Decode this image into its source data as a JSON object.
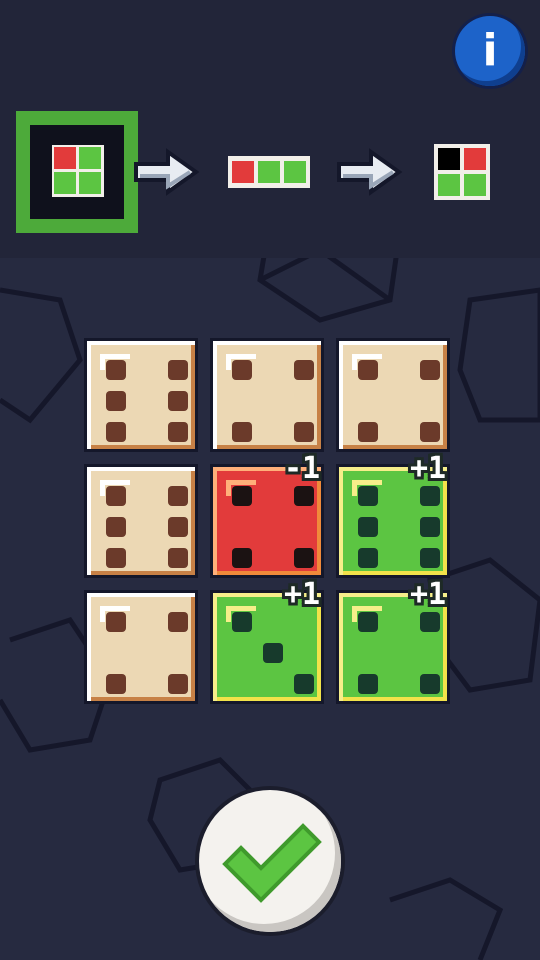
{
  "info_button": {
    "label": "i",
    "color": "#1d63c9"
  },
  "recipe": {
    "selected_pattern": {
      "cells": [
        "#e23b3b",
        "#5cc542",
        "#5cc542",
        "#5cc542"
      ],
      "selected": true,
      "frame_color": "#4daa3a"
    },
    "arrow_icon": "arrow-right-icon",
    "middle_pattern": {
      "cells": [
        "#e23b3b",
        "#5cc542",
        "#5cc542"
      ]
    },
    "result_pattern": {
      "cells": [
        "#000000",
        "#e23b3b",
        "#5cc542",
        "#5cc542"
      ]
    }
  },
  "board": {
    "dice": [
      {
        "value": 6,
        "color": "cream",
        "badge": ""
      },
      {
        "value": 4,
        "color": "cream",
        "badge": ""
      },
      {
        "value": 4,
        "color": "cream",
        "badge": ""
      },
      {
        "value": 6,
        "color": "cream",
        "badge": ""
      },
      {
        "value": 4,
        "color": "red",
        "badge": "-1"
      },
      {
        "value": 6,
        "color": "green",
        "badge": "+1"
      },
      {
        "value": 4,
        "color": "cream",
        "badge": ""
      },
      {
        "value": 3,
        "color": "green",
        "badge": "+1"
      },
      {
        "value": 4,
        "color": "green",
        "badge": "+1"
      }
    ]
  },
  "confirm_button": {
    "icon": "checkmark-icon",
    "color": "#5cc542"
  }
}
